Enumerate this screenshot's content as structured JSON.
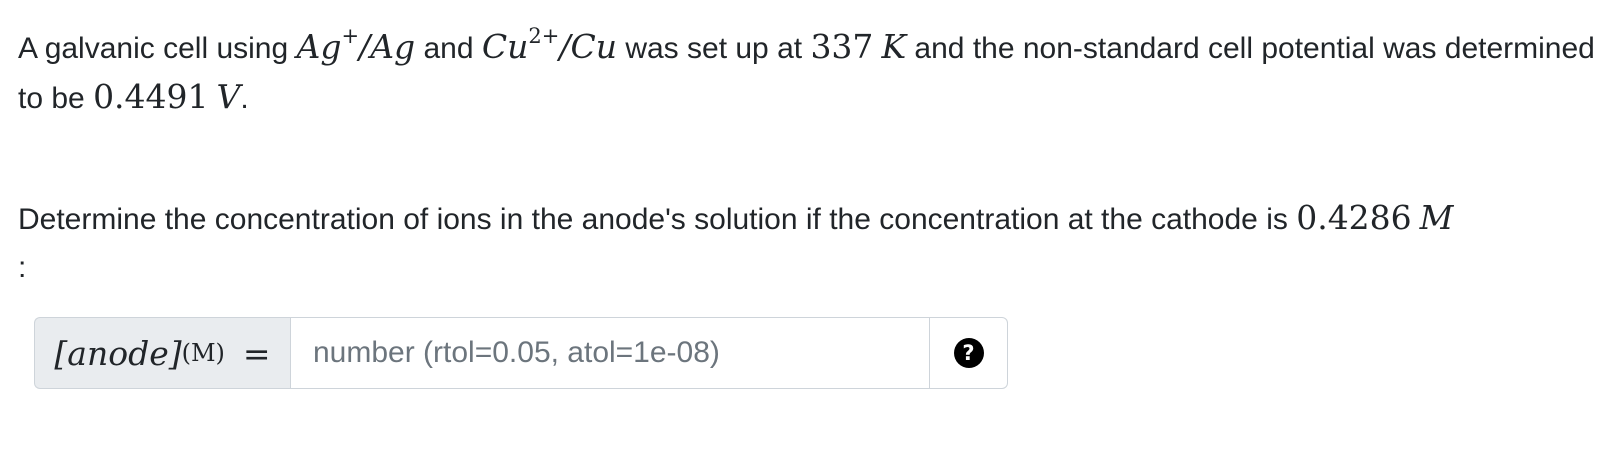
{
  "question": {
    "p1": {
      "t1": "A galvanic cell using ",
      "m_ag_base": "Ag",
      "m_ag_sup": "+",
      "m_ag_rest": "/Ag",
      "t2": " and ",
      "m_cu_base": "Cu",
      "m_cu_sup": "2+",
      "m_cu_rest": "/Cu",
      "t3": " was set up at ",
      "m_temp_num": "337",
      "m_temp_unit": "K",
      "t4": " and the non-standard cell potential was determined to be ",
      "m_pot_num": "0.4491",
      "m_pot_unit": "V",
      "t5": "."
    },
    "p2": {
      "t1": "Determine the concentration of ions in the anode's solution if the concentration at the cathode is ",
      "m_conc_num": "0.4286",
      "m_conc_unit": "M",
      "t2": ":"
    }
  },
  "answer": {
    "label_var": "[anode]",
    "label_unit": "(M)",
    "label_eq": "=",
    "placeholder": "number (rtol=0.05, atol=1e-08)",
    "value": "",
    "help_icon": "question-circle-icon",
    "help_glyph": "?"
  }
}
